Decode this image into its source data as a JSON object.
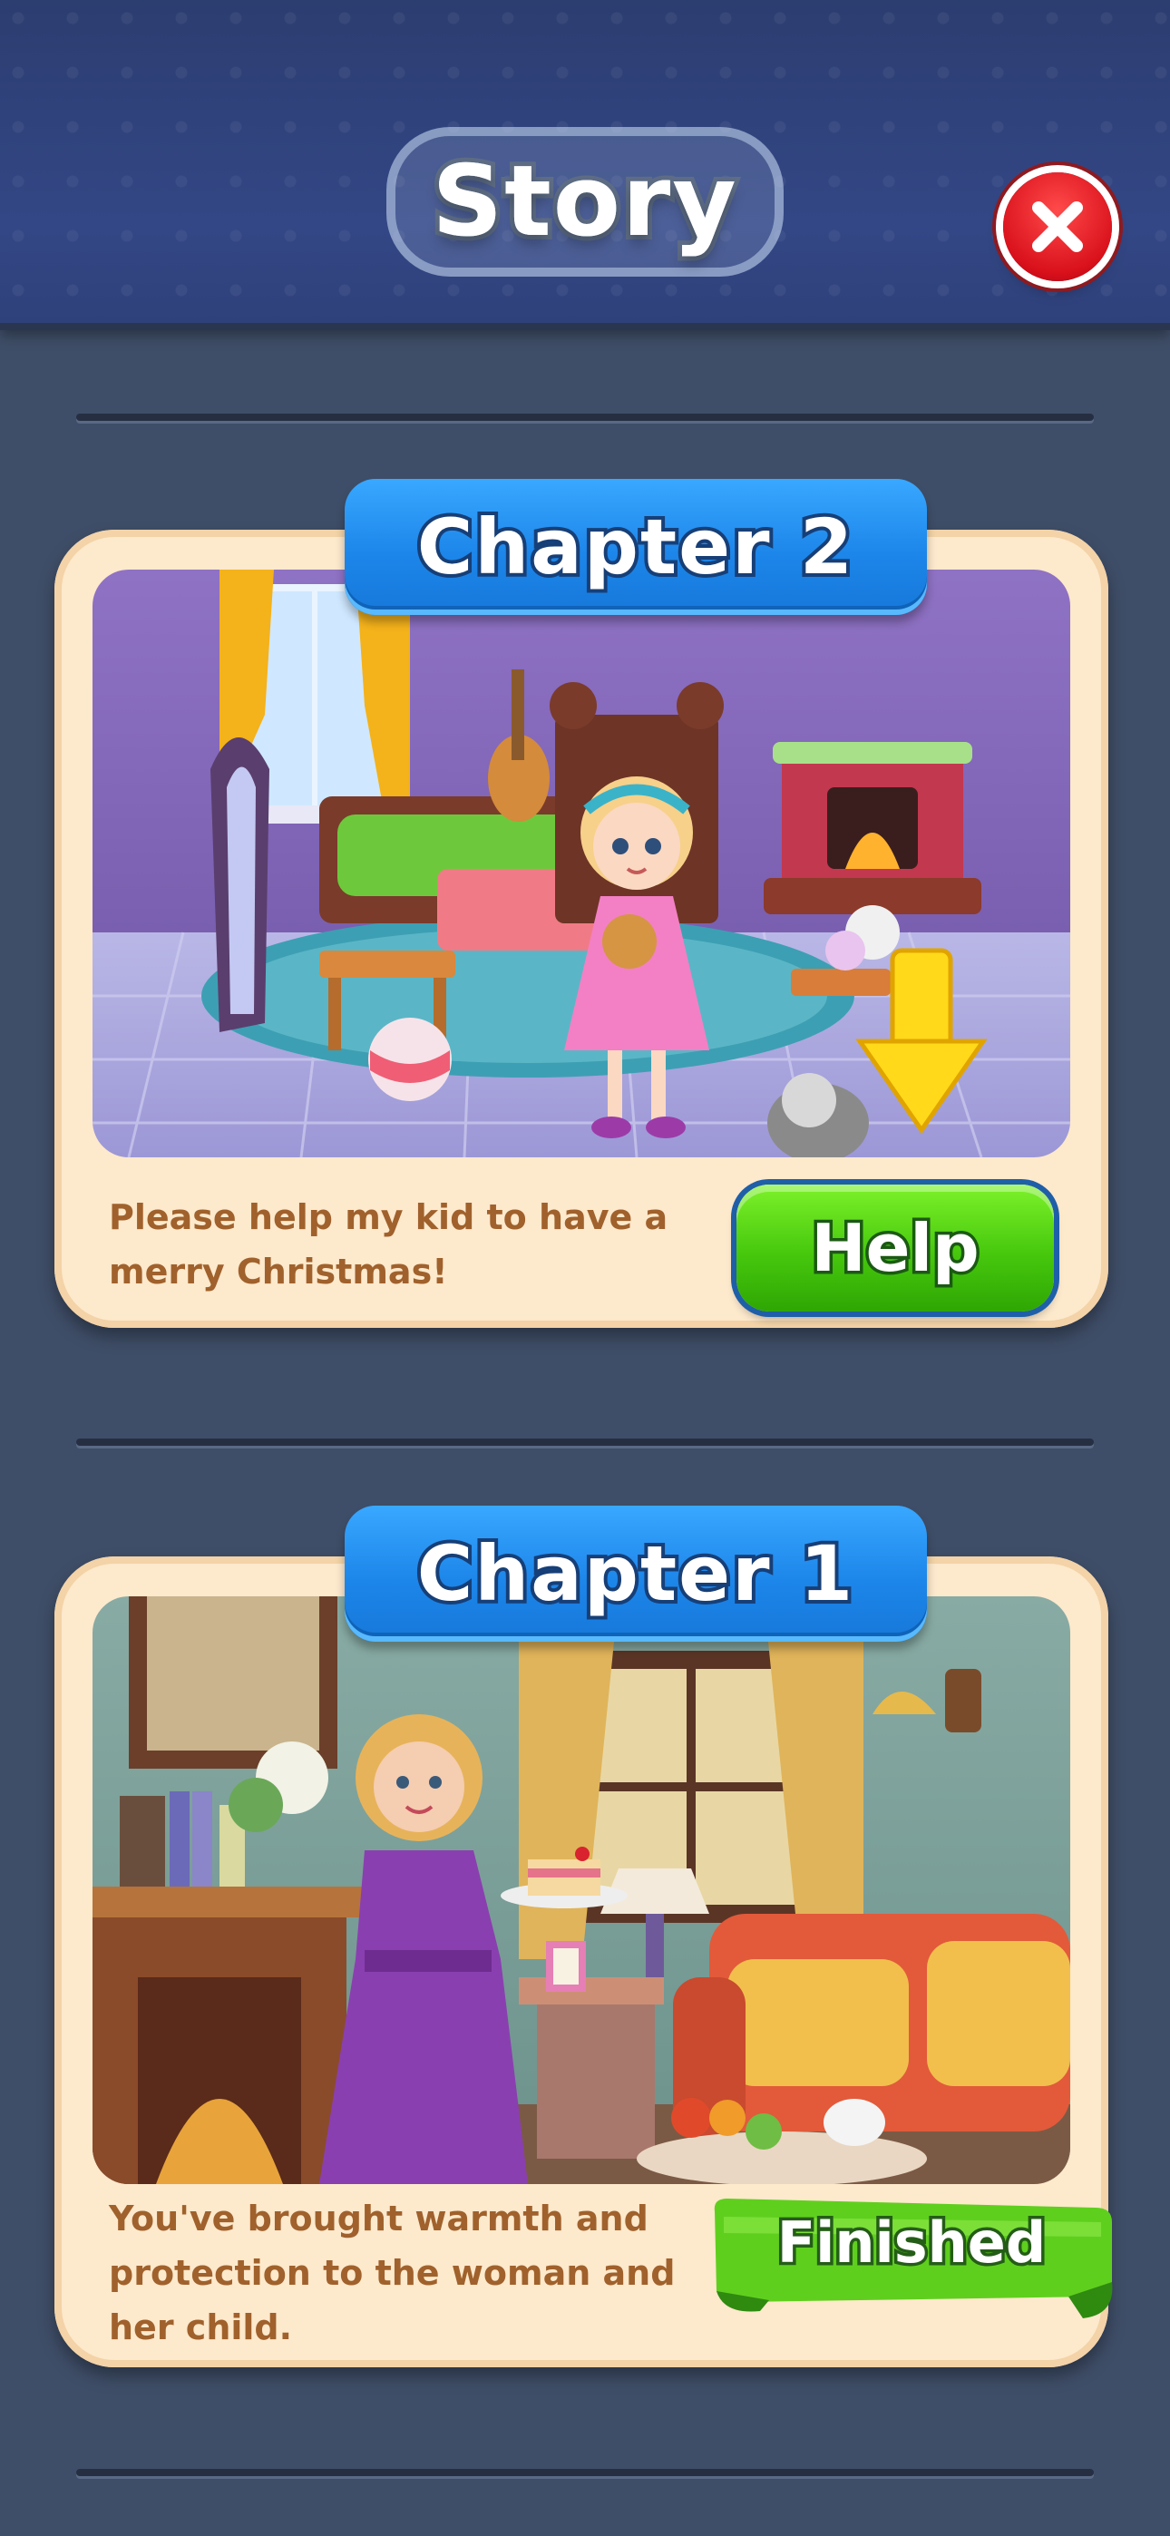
{
  "header": {
    "title": "Story"
  },
  "chapters": [
    {
      "label": "Chapter 2",
      "description_line1": "Please help my kid to have a",
      "description_line2": "merry Christmas!",
      "action_label": "Help"
    },
    {
      "label": "Chapter 1",
      "description_line1": "You've brought warmth and",
      "description_line2": "protection to the woman and",
      "description_line3": "her child.",
      "status_label": "Finished"
    }
  ],
  "colors": {
    "background": "#3f4e68",
    "header": "#334786",
    "card": "#fde9cc",
    "banner_blue": "#1d86ea",
    "help_green": "#46c80d",
    "close_red": "#d9111b",
    "text_brown": "#a0612c"
  },
  "icons": {
    "close": "close-icon",
    "arrow": "down-arrow-icon"
  }
}
